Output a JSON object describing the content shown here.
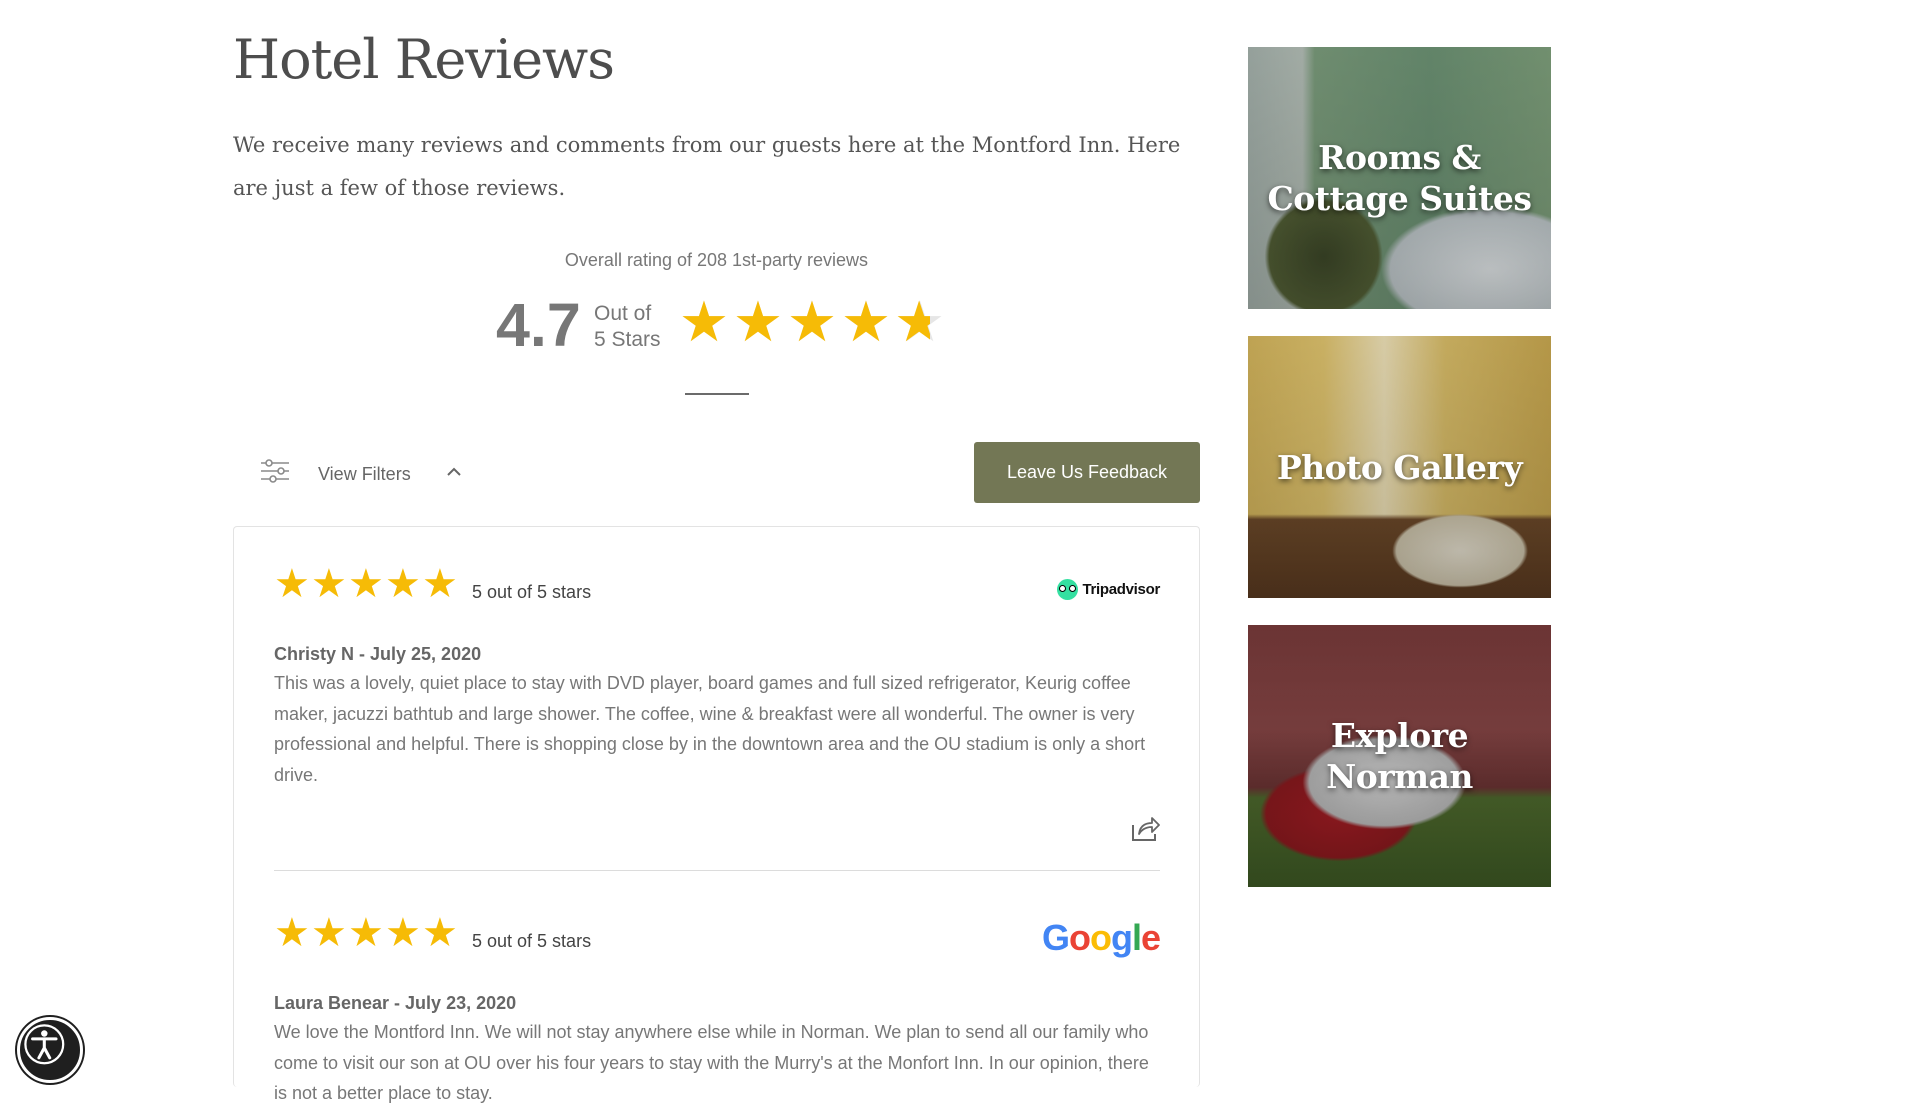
{
  "page": {
    "title": "Hotel Reviews",
    "intro": "We receive many reviews and comments from our guests here at the Montford Inn. Here are just a few of those reviews."
  },
  "summary": {
    "caption": "Overall rating of 208 1st-party reviews",
    "rating": "4.7",
    "out_of_line1": "Out of",
    "out_of_line2": "5 Stars",
    "rating_value": 4.7,
    "max_stars": 5
  },
  "filters": {
    "label": "View Filters",
    "feedback_button": "Leave Us Feedback"
  },
  "reviews": [
    {
      "stars": 5,
      "rating_text": "5 out of 5 stars",
      "source": "Tripadvisor",
      "author_date": "Christy N - July 25, 2020",
      "text": "This was a lovely, quiet place to stay with DVD player, board games and full sized refrigerator, Keurig coffee maker, jacuzzi bathtub and large shower. The coffee, wine & breakfast were all wonderful. The owner is very professional and helpful. There is shopping close by in the downtown area and the OU stadium is only a short drive."
    },
    {
      "stars": 5,
      "rating_text": "5 out of 5 stars",
      "source": "Google",
      "author_date": "Laura Benear - July 23, 2020",
      "text": "We love the Montford Inn. We will not stay anywhere else while in Norman. We plan to send all our family who come to visit our son at OU over his four years to stay with the Murry's at the Monfort Inn. In our opinion, there is not a better place to stay."
    }
  ],
  "sidebar": {
    "tiles": [
      {
        "label_line1": "Rooms &",
        "label_line2": "Cottage Suites"
      },
      {
        "label_line1": "Photo Gallery",
        "label_line2": ""
      },
      {
        "label_line1": "Explore",
        "label_line2": "Norman"
      }
    ]
  },
  "icons": {
    "star": "★",
    "filter": "filter-sliders-icon",
    "chevron": "chevron-up-icon",
    "share": "share-icon",
    "accessibility": "accessibility-icon"
  },
  "colors": {
    "star": "#f6bb06",
    "star_empty": "#e6e6e6",
    "button": "#737755",
    "google_blue": "#4285F4",
    "google_red": "#EA4335",
    "google_yellow": "#FBBC05",
    "google_green": "#34A853",
    "tripadvisor_green": "#34e0a1"
  }
}
